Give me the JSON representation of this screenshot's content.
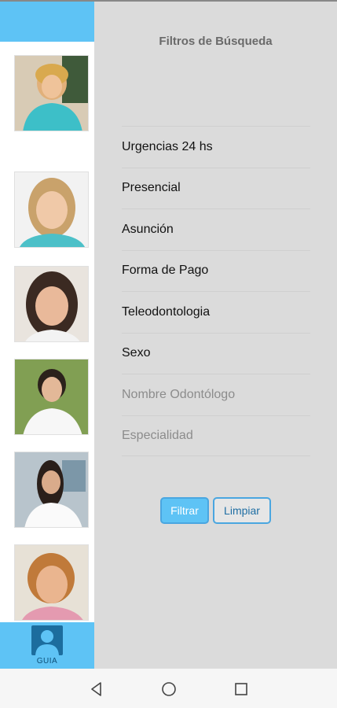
{
  "drawer": {
    "title": "Filtros de Búsqueda",
    "filters": [
      {
        "label": "Urgencias 24 hs"
      },
      {
        "label": "Presencial"
      },
      {
        "label": "Asunción"
      },
      {
        "label": "Forma de Pago"
      },
      {
        "label": "Teleodontologia"
      },
      {
        "label": "Sexo"
      },
      {
        "label": "Nombre Odontólogo"
      },
      {
        "label": "Especialidad"
      }
    ],
    "filter_button": "Filtrar",
    "clear_button": "Limpiar"
  },
  "bottom_tab": {
    "label": "GUIA",
    "icon": "person-icon"
  },
  "colors": {
    "accent": "#5ec3f5",
    "drawer_bg": "#dbdbdb",
    "button_border": "#4aa6e0"
  },
  "navbar": {
    "icons": [
      "back-icon",
      "home-icon",
      "recents-icon"
    ]
  }
}
